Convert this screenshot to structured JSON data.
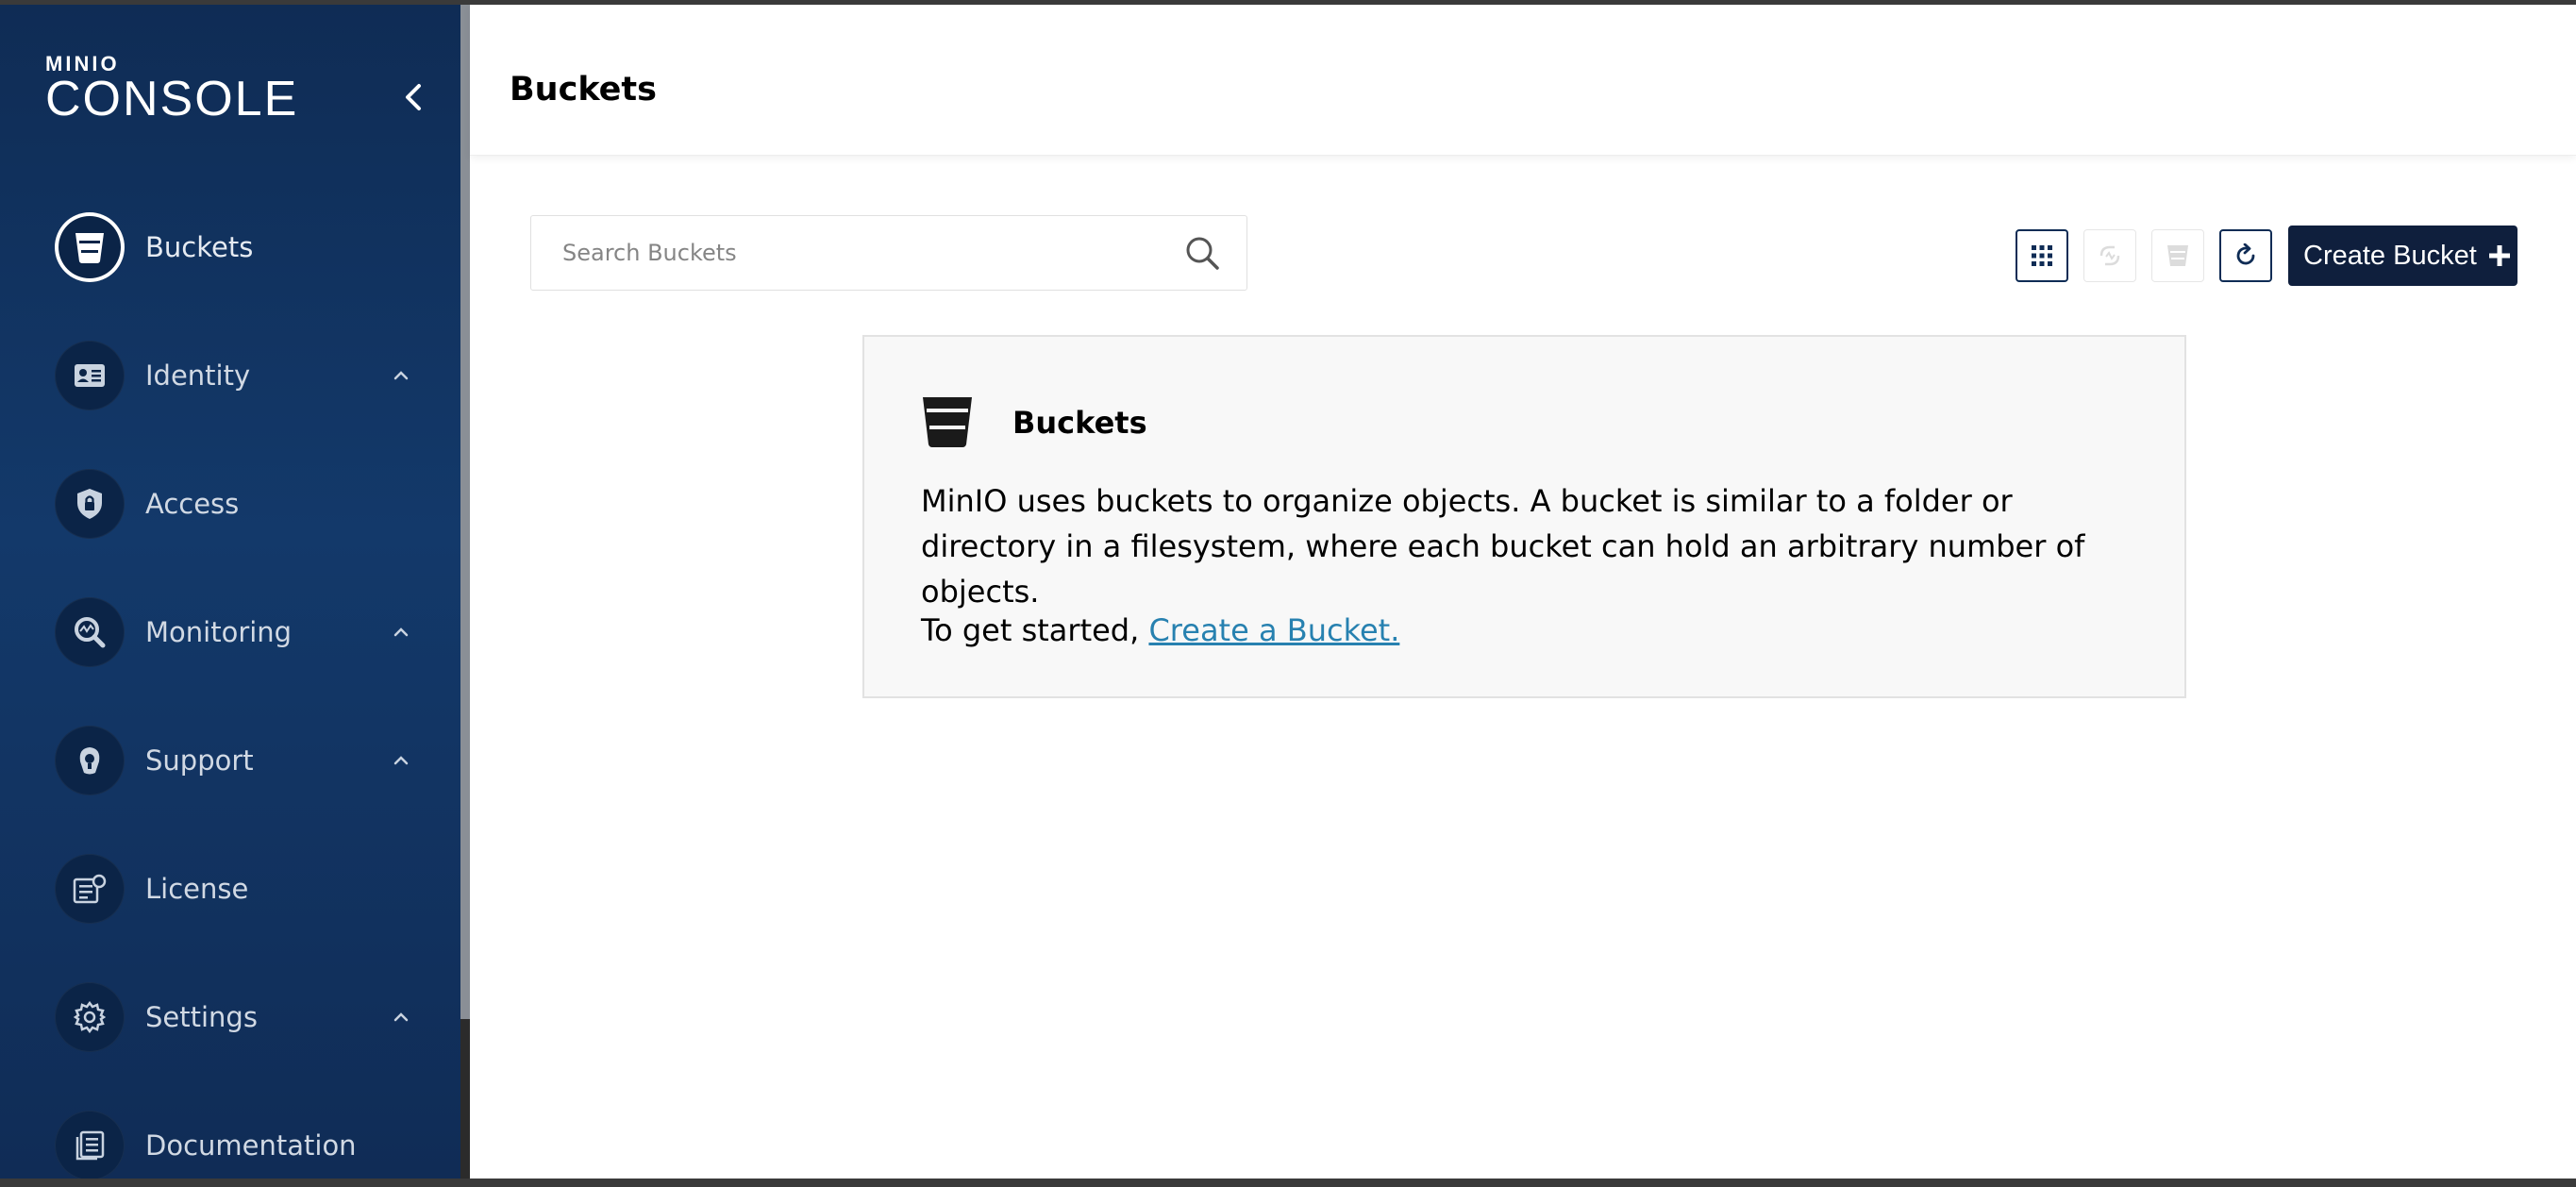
{
  "logo": {
    "top": "MINIO",
    "bottom": "CONSOLE"
  },
  "sidebar": {
    "items": [
      {
        "label": "Buckets",
        "icon": "bucket-icon",
        "active": true,
        "expandable": false
      },
      {
        "label": "Identity",
        "icon": "identity-card-icon",
        "active": false,
        "expandable": true
      },
      {
        "label": "Access",
        "icon": "shield-lock-icon",
        "active": false,
        "expandable": false
      },
      {
        "label": "Monitoring",
        "icon": "monitoring-magnifier-icon",
        "active": false,
        "expandable": true
      },
      {
        "label": "Support",
        "icon": "support-headset-icon",
        "active": false,
        "expandable": true
      },
      {
        "label": "License",
        "icon": "license-certificate-icon",
        "active": false,
        "expandable": false
      },
      {
        "label": "Settings",
        "icon": "gear-icon",
        "active": false,
        "expandable": true
      },
      {
        "label": "Documentation",
        "icon": "documentation-icon",
        "active": false,
        "expandable": false
      }
    ]
  },
  "header": {
    "title": "Buckets"
  },
  "search": {
    "placeholder": "Search Buckets",
    "value": ""
  },
  "toolbar": {
    "buttons": [
      {
        "name": "grid-view-button",
        "icon": "grid-icon",
        "enabled": true
      },
      {
        "name": "replication-button",
        "icon": "replication-icon",
        "enabled": false
      },
      {
        "name": "delete-bucket-button",
        "icon": "bucket-delete-icon",
        "enabled": false
      },
      {
        "name": "refresh-button",
        "icon": "refresh-icon",
        "enabled": true
      }
    ],
    "create_label": "Create Bucket"
  },
  "card": {
    "title": "Buckets",
    "body": "MinIO uses buckets to organize objects. A bucket is similar to a folder or directory in a filesystem, where each bucket can hold an arbitrary number of objects.",
    "cta_prefix": "To get started,",
    "cta_link": "Create a Bucket."
  },
  "colors": {
    "sidebar_bg": "#13396a",
    "primary_button": "#0f1f3d",
    "link": "#2781b0",
    "card_bg": "#f8f8f8"
  }
}
